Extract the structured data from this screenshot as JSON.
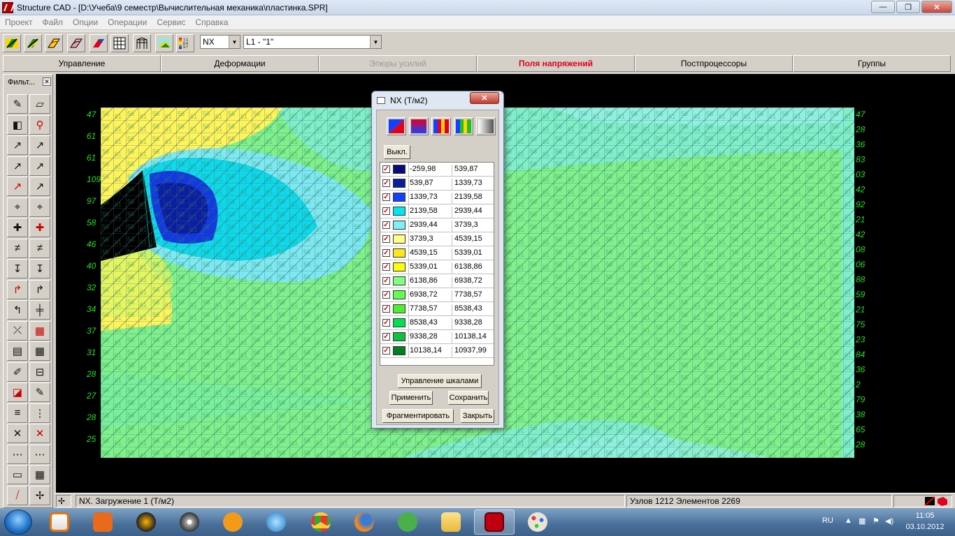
{
  "window": {
    "title": "Structure CAD  - [D:\\Учеба\\9 семестр\\Вычислительная механика\\пластинка.SPR]",
    "controls": {
      "minimize": "—",
      "maximize": "❐",
      "close": "✕"
    }
  },
  "menu": [
    "Проект",
    "Файл",
    "Опции",
    "Операции",
    "Сервис",
    "Справка"
  ],
  "toolbar": {
    "factor_select": "NX",
    "load_select": "L1 - \"1\""
  },
  "tabs": [
    {
      "label": "Управление",
      "state": "normal"
    },
    {
      "label": "Деформации",
      "state": "normal"
    },
    {
      "label": "Эпюры усилий",
      "state": "disabled"
    },
    {
      "label": "Поля напряжений",
      "state": "active"
    },
    {
      "label": "Постпроцессоры",
      "state": "normal"
    },
    {
      "label": "Группы",
      "state": "normal"
    }
  ],
  "filter_panel": {
    "title": "Фильт...",
    "close": "✕",
    "tools": [
      "pencil-icon",
      "eraser-icon",
      "cube-icon",
      "filter-icon",
      "node-number-icon",
      "node-number-x-icon",
      "node-ne-icon",
      "node-nj-icon",
      "element-type-icon",
      "rigidity-icon",
      "support-icon",
      "hinge-icon",
      "axis-icon",
      "axis-local-icon",
      "plate-icon",
      "beam-icon",
      "load-icon",
      "load-down-icon",
      "force-f-icon",
      "moment-icon",
      "node-m-icon",
      "spring-icon",
      "fragment-icon",
      "grid-icon",
      "mesh-icon",
      "mesh-split-icon",
      "pen-icon",
      "contour-icon",
      "stress-field-icon",
      "brush-icon",
      "stack-icon",
      "nodes-icon",
      "label-n-icon",
      "label-g-icon",
      "group-icon",
      "group-x-icon",
      "select-box-icon",
      "select-grid-icon",
      "line-icon",
      "pin-icon"
    ]
  },
  "dialog": {
    "title": "NX (Т/м2)",
    "close": "✕",
    "off_button": "Выкл.",
    "legend": [
      {
        "from": "-259,98",
        "to": "539,87",
        "color": "#0a0a78"
      },
      {
        "from": "539,87",
        "to": "1339,73",
        "color": "#0b1ea0"
      },
      {
        "from": "1339,73",
        "to": "2139,58",
        "color": "#1240ff"
      },
      {
        "from": "2139,58",
        "to": "2939,44",
        "color": "#00e6f0"
      },
      {
        "from": "2939,44",
        "to": "3739,3",
        "color": "#7ef0f4"
      },
      {
        "from": "3739,3",
        "to": "4539,15",
        "color": "#ffff80"
      },
      {
        "from": "4539,15",
        "to": "5339,01",
        "color": "#ffe81a"
      },
      {
        "from": "5339,01",
        "to": "6138,86",
        "color": "#ffff00"
      },
      {
        "from": "6138,86",
        "to": "6938,72",
        "color": "#80ff80"
      },
      {
        "from": "6938,72",
        "to": "7738,57",
        "color": "#60ff50"
      },
      {
        "from": "7738,57",
        "to": "8538,43",
        "color": "#50ee30"
      },
      {
        "from": "8538,43",
        "to": "9338,28",
        "color": "#00e050"
      },
      {
        "from": "9338,28",
        "to": "10138,14",
        "color": "#10c040"
      },
      {
        "from": "10138,14",
        "to": "10937,99",
        "color": "#008020"
      }
    ],
    "buttons": {
      "scales": "Управление шкалами",
      "apply": "Применить",
      "save": "Сохранить",
      "fragment": "Фрагментировать",
      "close_btn": "Закрыть"
    }
  },
  "status": {
    "mode": "NX. Загружение 1 (Т/м2)",
    "counts": "Узлов 1212 Элементов 2269"
  },
  "taskbar": {
    "lang": "RU",
    "time": "11:05",
    "date": "03.10.2012"
  },
  "canvas_labels": {
    "left": [
      "47",
      "61",
      "61",
      "109",
      "97",
      "58",
      "46",
      "40",
      "32",
      "34",
      "37",
      "31",
      "28",
      "27",
      "28",
      "25"
    ],
    "right": [
      "47",
      "28",
      "36",
      "83",
      "03",
      "42",
      "92",
      "21",
      "42",
      "08",
      "06",
      "88",
      "59",
      "21",
      "75",
      "23",
      "84",
      "36",
      "2",
      "79",
      "38",
      "65",
      "28"
    ]
  }
}
